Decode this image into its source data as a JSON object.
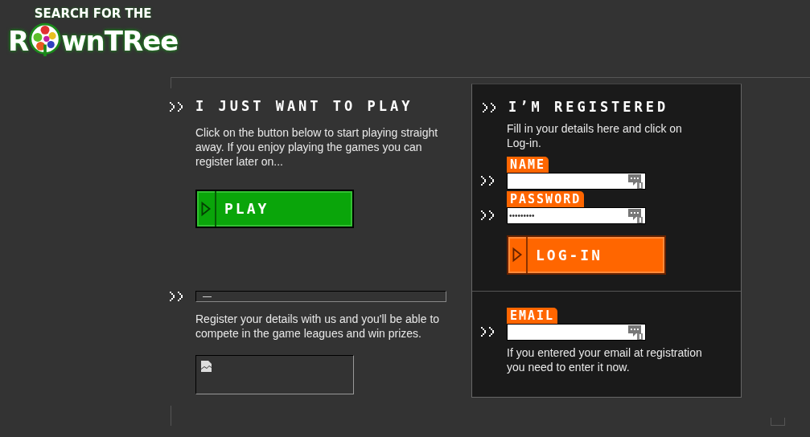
{
  "logo": {
    "tagline": "SEARCH FOR THE",
    "word_start": "R",
    "word_end": "wnTRee"
  },
  "play_section": {
    "heading": "I JUST WANT TO PLAY",
    "text": "Click on the button below to start playing straight away. If you enjoy playing the games you can register later on...",
    "button": "PLAY"
  },
  "register_section": {
    "field_value": "—",
    "text": "Register your details with us and you'll be able to compete in the game leagues and win prizes.",
    "image": {
      "kind": "broken-image"
    }
  },
  "login_section": {
    "heading": "I’M REGISTERED",
    "text": "Fill in your details here and click on Log-in.",
    "fields": [
      {
        "label": "NAME"
      },
      {
        "label": "PASSWORD",
        "value": "•••••••••"
      }
    ],
    "button": "LOG-IN"
  },
  "email_section": {
    "label": "EMAIL",
    "text": "If you entered your email at registration you need to enter it now."
  }
}
